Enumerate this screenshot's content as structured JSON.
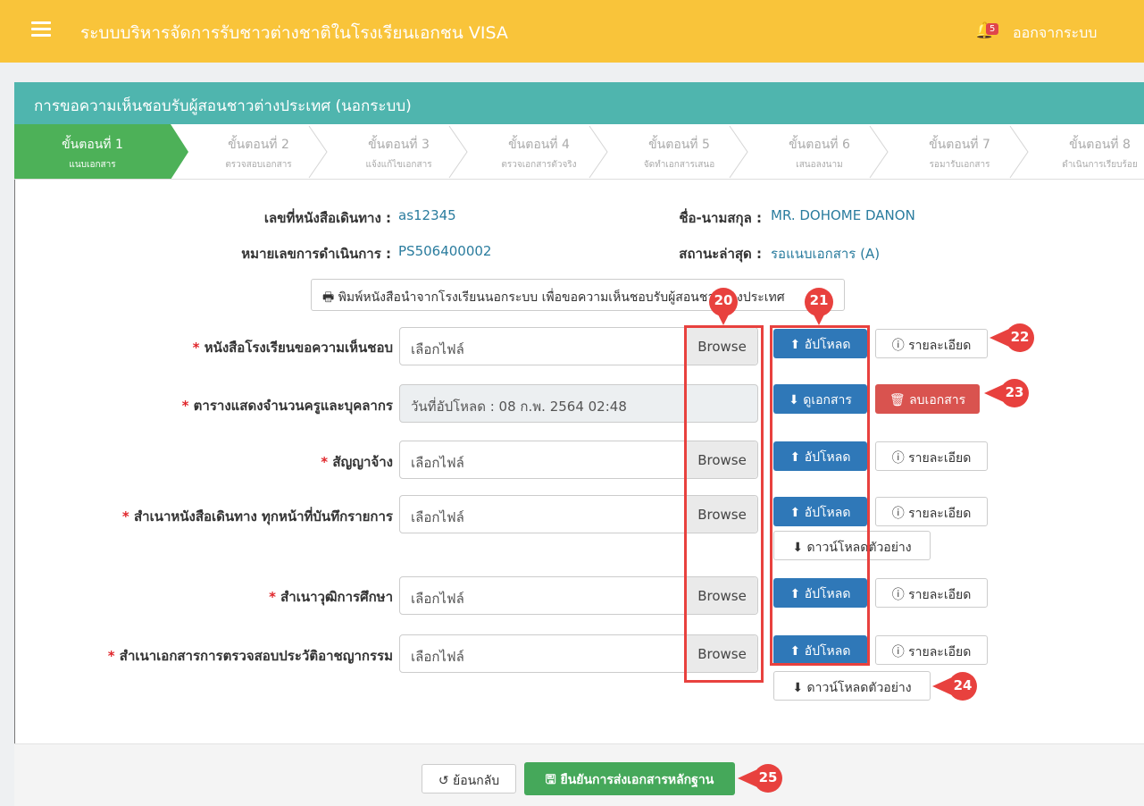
{
  "topbar": {
    "menu_icon": "hamburger-icon",
    "app_title": "ระบบบริหารจัดการรับชาวต่างชาติในโรงเรียนเอกชน VISA",
    "bell_icon": "bell-icon",
    "notification_count": "5",
    "logout_label": "ออกจากระบบ"
  },
  "page": {
    "header_title": "การขอความเห็นชอบรับผู้สอนชาวต่างประเทศ (นอกระบบ)"
  },
  "steps": [
    {
      "title": "ขั้นตอนที่ 1",
      "subtitle": "แนบเอกสาร",
      "active": true
    },
    {
      "title": "ขั้นตอนที่ 2",
      "subtitle": "ตรวจสอบเอกสาร",
      "active": false
    },
    {
      "title": "ขั้นตอนที่ 3",
      "subtitle": "แจ้งแก้ไขเอกสาร",
      "active": false
    },
    {
      "title": "ขั้นตอนที่ 4",
      "subtitle": "ตรวจเอกสารตัวจริง",
      "active": false
    },
    {
      "title": "ขั้นตอนที่ 5",
      "subtitle": "จัดทำเอกสารเสนอ",
      "active": false
    },
    {
      "title": "ขั้นตอนที่ 6",
      "subtitle": "เสนอลงนาม",
      "active": false
    },
    {
      "title": "ขั้นตอนที่ 7",
      "subtitle": "รอมารับเอกสาร",
      "active": false
    },
    {
      "title": "ขั้นตอนที่ 8",
      "subtitle": "ดำเนินการเรียบร้อย",
      "active": false
    }
  ],
  "info": {
    "passport_label": "เลขที่หนังสือเดินทาง :",
    "passport_value": "as12345",
    "name_label": "ชื่อ-นามสกุล :",
    "name_value": "MR. DOHOME DANON",
    "ref_label": "หมายเลขการดำเนินการ :",
    "ref_value": "PS506400002",
    "status_label": "สถานะล่าสุด :",
    "status_value": "รอแนบเอกสาร (A)"
  },
  "print_button": {
    "icon": "printer-icon",
    "label": "พิมพ์หนังสือนำจากโรงเรียนนอกระบบ เพื่อขอความเห็นชอบรับผู้สอนชาวต่างประเทศ"
  },
  "documents": [
    {
      "label": "หนังสือโรงเรียนขอความเห็นชอบ",
      "file_placeholder": "เลือกไฟล์",
      "browse": "Browse",
      "action": "อัปโหลด",
      "secondary": "รายละเอียด"
    },
    {
      "label": "ตารางแสดงจำนวนครูและบุคลากร",
      "uploaded_text": "วันที่อัปโหลด  :  08 ก.พ. 2564 02:48",
      "action": "ดูเอกสาร",
      "secondary": "ลบเอกสาร"
    },
    {
      "label": "สัญญาจ้าง",
      "file_placeholder": "เลือกไฟล์",
      "browse": "Browse",
      "action": "อัปโหลด",
      "secondary": "รายละเอียด"
    },
    {
      "label": "สำเนาหนังสือเดินทาง ทุกหน้าที่บันทึกรายการ",
      "file_placeholder": "เลือกไฟล์",
      "browse": "Browse",
      "action": "อัปโหลด",
      "secondary": "รายละเอียด",
      "sample": "ดาวน์โหลดตัวอย่าง"
    },
    {
      "label": "สำเนาวุฒิการศึกษา",
      "file_placeholder": "เลือกไฟล์",
      "browse": "Browse",
      "action": "อัปโหลด",
      "secondary": "รายละเอียด"
    },
    {
      "label": "สำเนาเอกสารการตรวจสอบประวัติอาชญากรรม",
      "file_placeholder": "เลือกไฟล์",
      "browse": "Browse",
      "action": "อัปโหลด",
      "secondary": "รายละเอียด",
      "sample": "ดาวน์โหลดตัวอย่าง"
    }
  ],
  "required_mark": "*",
  "annotations": [
    "20",
    "21",
    "22",
    "23",
    "24",
    "25"
  ],
  "footer": {
    "back_label": "ย้อนกลับ",
    "confirm_label": "ยืนยันการส่งเอกสารหลักฐาน"
  },
  "colors": {
    "topbar": "#f9c43a",
    "header": "#4fb5ae",
    "step_active": "#4db158",
    "upload_button": "#2f78b8",
    "delete_button": "#d9534f",
    "confirm_button": "#45a85a",
    "annotation": "#e8413e"
  }
}
